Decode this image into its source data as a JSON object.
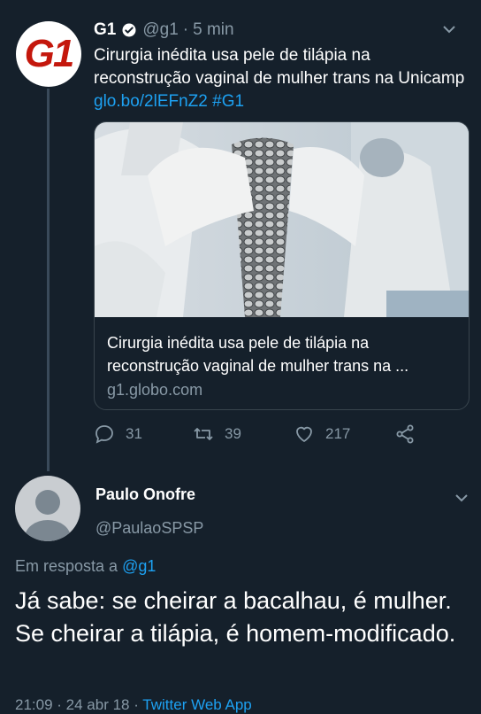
{
  "tweet": {
    "author_name": "G1",
    "handle": "@g1",
    "separator": "·",
    "time": "5 min",
    "text": "Cirurgia inédita usa pele de tilápia na reconstrução vaginal de mulher trans na Unicamp ",
    "link": "glo.bo/2lEFnZ2",
    "hashtag": "#G1",
    "avatar_text": "G1",
    "card": {
      "title": "Cirurgia inédita usa pele de tilápia na reconstrução vaginal de mulher trans na ...",
      "domain": "g1.globo.com"
    },
    "actions": {
      "replies": "31",
      "retweets": "39",
      "likes": "217"
    }
  },
  "reply": {
    "author_name": "Paulo Onofre",
    "handle": "@PaulaoSPSP",
    "reply_prefix": "Em resposta a ",
    "reply_to": "@g1",
    "text": "Já sabe: se cheirar a bacalhau, é mulher. Se cheirar a tilápia, é homem-modificado.",
    "meta_time": "21:09 · 24 abr 18 · ",
    "meta_source": "Twitter Web App"
  },
  "colors": {
    "background": "#15202b",
    "accent": "#1da1f2",
    "muted": "#8899a6",
    "g1_red": "#c4170c"
  },
  "icons": [
    "verified-badge-icon",
    "chevron-down-icon",
    "reply-icon",
    "retweet-icon",
    "like-icon",
    "share-icon",
    "default-avatar-icon"
  ]
}
